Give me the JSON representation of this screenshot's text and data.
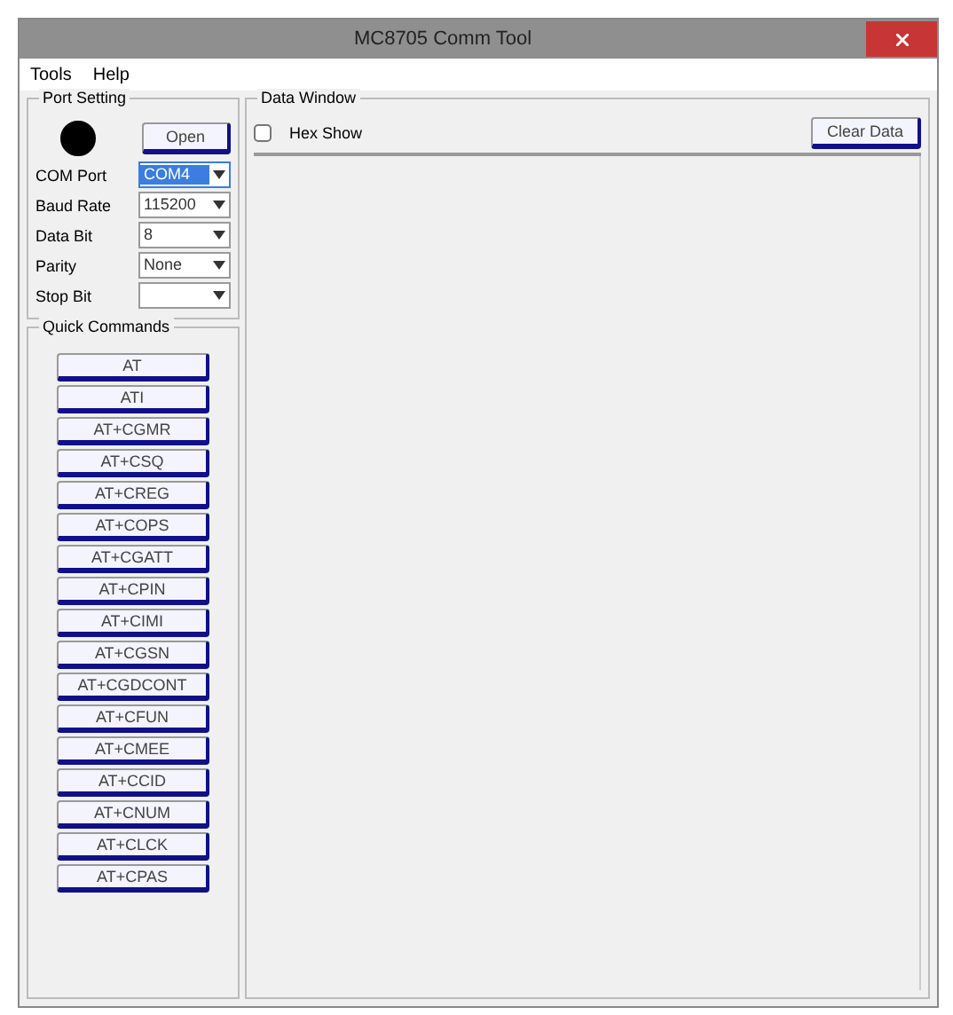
{
  "window": {
    "title": "MC8705 Comm Tool"
  },
  "menu": [
    "Tools",
    "Help"
  ],
  "port_settings": {
    "title": "Port Setting",
    "connected": true,
    "open_button": "Open",
    "fields": [
      {
        "label": "COM Port",
        "value": "COM4",
        "focused": true
      },
      {
        "label": "Baud Rate",
        "value": "115200",
        "focused": false
      },
      {
        "label": "Data Bit",
        "value": "8",
        "focused": false
      },
      {
        "label": "Parity",
        "value": "None",
        "focused": false
      },
      {
        "label": "Stop Bit",
        "focused": false
      }
    ]
  },
  "quick_commands": {
    "title": "Quick Commands",
    "buttons": [
      "AT",
      "ATI",
      "AT+CGMR",
      "AT+CSQ",
      "AT+CREG",
      "AT+COPS",
      "AT+CGATT",
      "AT+CPIN",
      "AT+CIMI",
      "AT+CGSN",
      "AT+CGDCONT",
      "AT+CFUN",
      "AT+CMEE",
      "AT+CCID",
      "AT+CNUM",
      "AT+CLCK",
      "AT+CPAS"
    ]
  },
  "data_window": {
    "title": "Data Window",
    "hex_show": {
      "label": "Hex Show",
      "checked": false
    },
    "clear_button": "Clear Data"
  }
}
